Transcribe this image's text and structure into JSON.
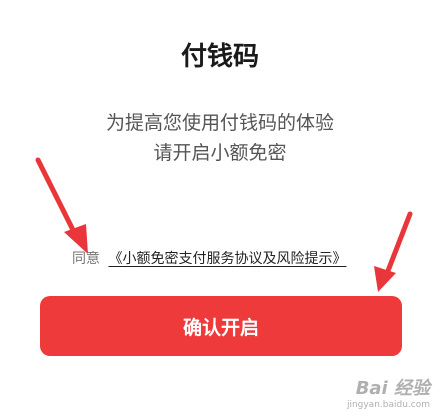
{
  "title": "付钱码",
  "description": {
    "line1": "为提高您使用付钱码的体验",
    "line2": "请开启小额免密"
  },
  "agreement": {
    "prefix": "同意",
    "link": "《小额免密支付服务协议及风险提示》"
  },
  "confirm_button": "确认开启",
  "watermark": {
    "logo": "Bai 经验",
    "site": "jingyan.baidu.com"
  },
  "colors": {
    "accent": "#ee3a3a",
    "arrow": "#e8363a"
  }
}
